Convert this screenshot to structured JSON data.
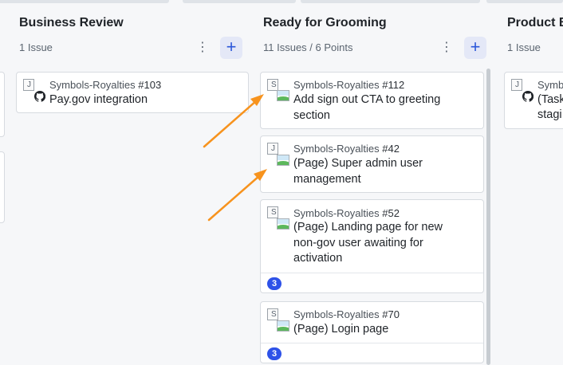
{
  "columns": [
    {
      "title": "Business Review",
      "meta": "1 Issue",
      "cards": [
        {
          "repo": "Symbols-Royalties",
          "number": "#103",
          "title": "Pay.gov integration",
          "avatar_alt": "J"
        }
      ]
    },
    {
      "title": "Ready for Grooming",
      "meta": "11 Issues / 6 Points",
      "cards": [
        {
          "repo": "Symbols-Royalties",
          "number": "#112",
          "title": "Add sign out CTA to greeting section",
          "avatar_alt": "S"
        },
        {
          "repo": "Symbols-Royalties",
          "number": "#42",
          "title": "(Page) Super admin user management",
          "avatar_alt": "J"
        },
        {
          "repo": "Symbols-Royalties",
          "number": "#52",
          "title": "(Page) Landing page for new non-gov user awaiting for activation",
          "avatar_alt": "S",
          "estimate": "3"
        },
        {
          "repo": "Symbols-Royalties",
          "number": "#70",
          "title": "(Page) Login page",
          "avatar_alt": "S",
          "estimate": "3"
        }
      ]
    },
    {
      "title": "Product B",
      "meta": "1 Issue",
      "cards": [
        {
          "repo": "Symb",
          "title": "(Task",
          "title_line2": "stagi",
          "avatar_alt": "J"
        }
      ]
    }
  ],
  "icons": {
    "kebab": "⋮",
    "add": "+"
  },
  "colors": {
    "accent": "#2e52e8",
    "annotation_arrow": "#f7931e"
  }
}
